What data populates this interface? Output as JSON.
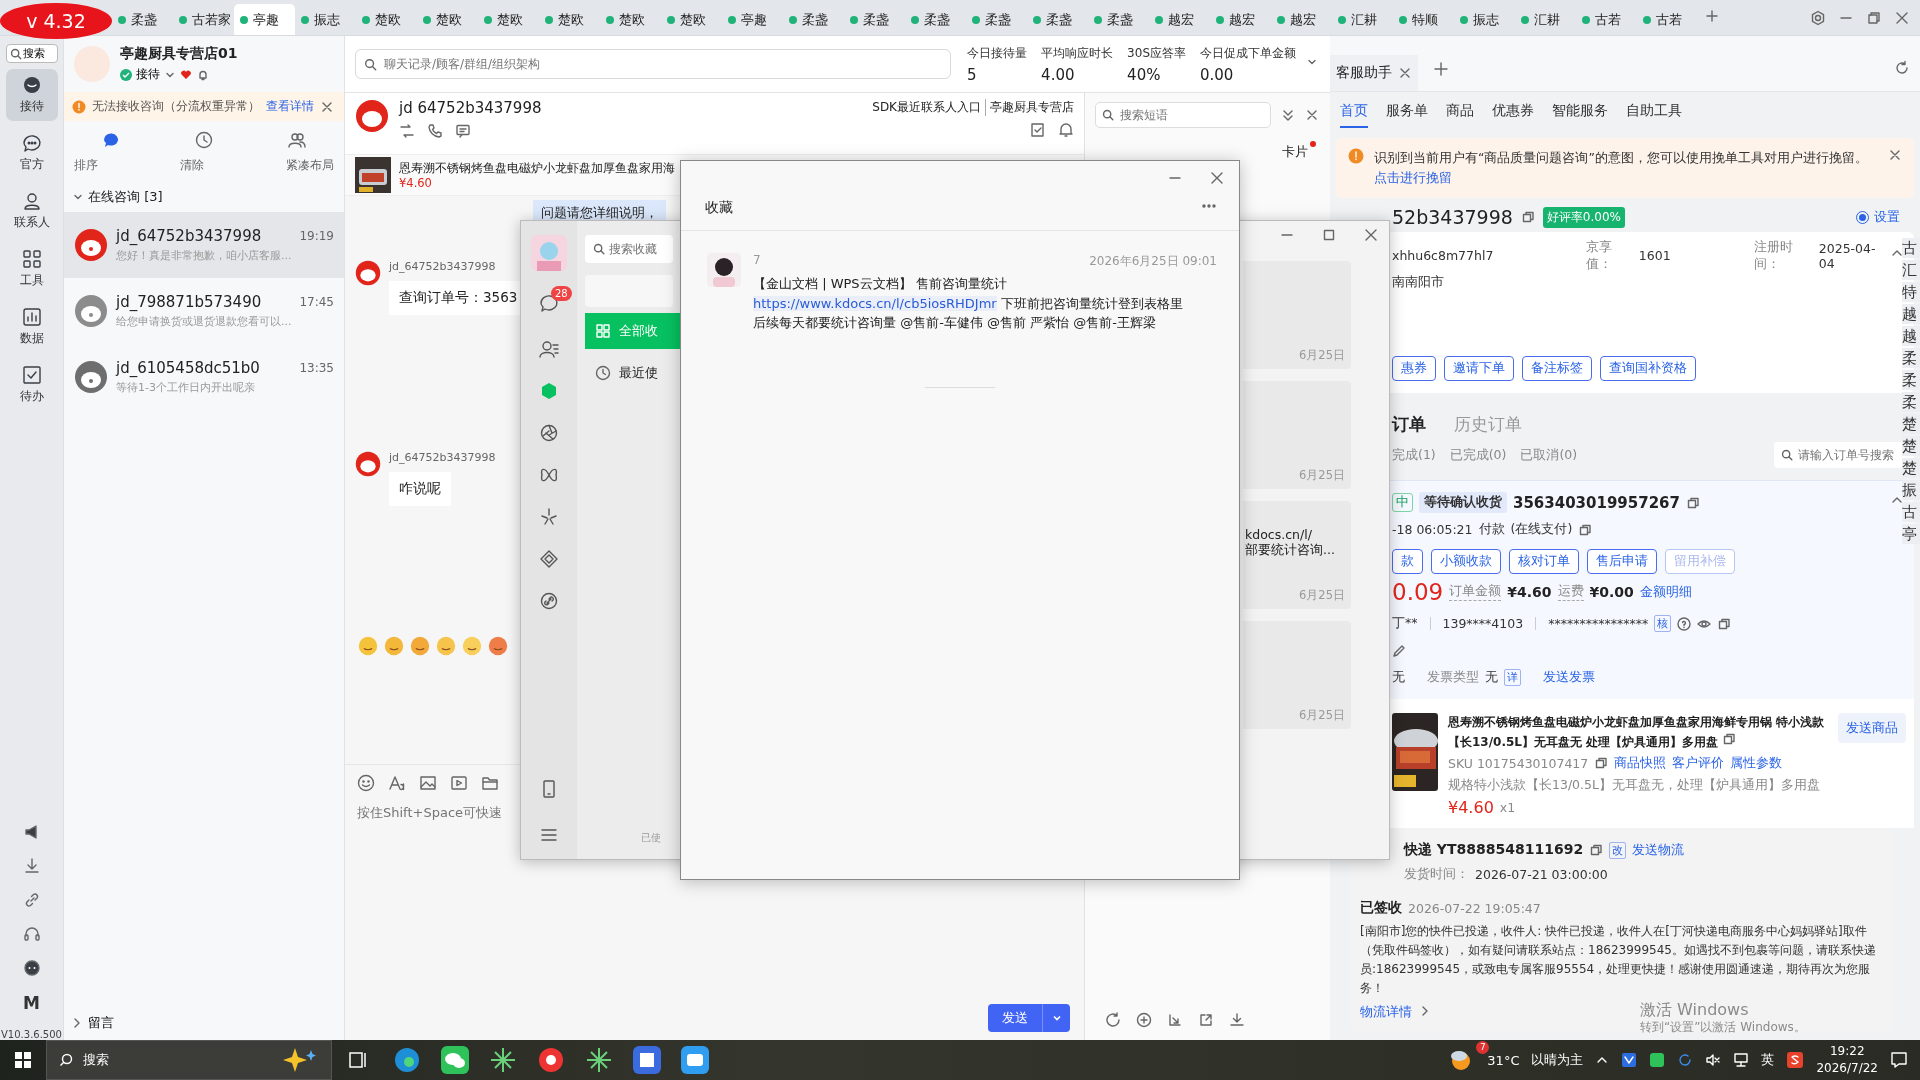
{
  "version_badge": "v 4.32",
  "top_tabs": [
    {
      "label": "柔盏",
      "selected": false
    },
    {
      "label": "古若家",
      "selected": false
    },
    {
      "label": "亭趣",
      "selected": true
    },
    {
      "label": "振志",
      "selected": false
    },
    {
      "label": "楚欧",
      "selected": false
    },
    {
      "label": "楚欧",
      "selected": false
    },
    {
      "label": "楚欧",
      "selected": false
    },
    {
      "label": "楚欧",
      "selected": false
    },
    {
      "label": "楚欧",
      "selected": false
    },
    {
      "label": "楚欧",
      "selected": false
    },
    {
      "label": "亭趣",
      "selected": false
    },
    {
      "label": "柔盏",
      "selected": false
    },
    {
      "label": "柔盏",
      "selected": false
    },
    {
      "label": "柔盏",
      "selected": false
    },
    {
      "label": "柔盏",
      "selected": false
    },
    {
      "label": "柔盏",
      "selected": false
    },
    {
      "label": "柔盏",
      "selected": false
    },
    {
      "label": "越宏",
      "selected": false
    },
    {
      "label": "越宏",
      "selected": false
    },
    {
      "label": "越宏",
      "selected": false
    },
    {
      "label": "汇耕",
      "selected": false
    },
    {
      "label": "特顺",
      "selected": false
    },
    {
      "label": "振志",
      "selected": false
    },
    {
      "label": "汇耕",
      "selected": false
    },
    {
      "label": "古若",
      "selected": false
    },
    {
      "label": "古若",
      "selected": false
    }
  ],
  "nav_rail": {
    "search": "搜索",
    "items": [
      {
        "label": "接待",
        "selected": true
      },
      {
        "label": "官方",
        "selected": false
      },
      {
        "label": "联系人",
        "selected": false
      },
      {
        "label": "工具",
        "selected": false
      },
      {
        "label": "数据",
        "selected": false
      },
      {
        "label": "待办",
        "selected": false
      }
    ],
    "letter": "M",
    "version": "V10.3.6.500"
  },
  "shop": {
    "name": "亭趣厨具专营店01",
    "status": "接待"
  },
  "list_alert": {
    "text": "无法接收咨询（分流权重异常）",
    "link": "查看详情"
  },
  "list_tools": [
    "排序",
    "清除",
    "紧凑布局"
  ],
  "conversations": {
    "group": "在线咨询 [3]",
    "items": [
      {
        "name": "jd_64752b3437998",
        "time": "19:19",
        "preview": "您好！真是非常抱歉，咱小店客服...",
        "selected": true,
        "color": "#e1251b"
      },
      {
        "name": "jd_798871b573490",
        "time": "17:45",
        "preview": "给您申请换货或退货退款您看可以...",
        "selected": false,
        "color": "#8c8c8c"
      },
      {
        "name": "jd_6105458dc51b0",
        "time": "13:35",
        "preview": "等待1-3个工作日内开出呢亲",
        "selected": false,
        "color": "#6e6e6e"
      }
    ]
  },
  "leave_message": "留言",
  "search": {
    "placeholder": "聊天记录/顾客/群组/组织架构"
  },
  "stats": [
    {
      "label": "今日接待量",
      "value": "5"
    },
    {
      "label": "平均响应时长",
      "value": "4.00"
    },
    {
      "label": "30S应答率",
      "value": "40%"
    },
    {
      "label": "今日促成下单金额",
      "value": "0.00"
    }
  ],
  "chat": {
    "customer": "jd 64752b3437998",
    "links": [
      "SDK最近联系人入口",
      "亭趣厨具专营店"
    ],
    "product": {
      "title": "恩寿溯不锈钢烤鱼盘电磁炉小龙虾盘加厚鱼盘家用海",
      "price": "¥4.60"
    },
    "messages": [
      {
        "kind": "agent",
        "text": "问题请您详细说明，"
      },
      {
        "kind": "customer",
        "sender": "jd_64752b3437998",
        "text": "查询订单号：3563"
      },
      {
        "kind": "customer",
        "sender": "jd_64752b3437998",
        "text": "咋说呢"
      }
    ],
    "input_placeholder": "按住Shift+Space可快速",
    "send": "发送"
  },
  "quick_reply": {
    "search_placeholder": "搜索短语",
    "tab": "卡片"
  },
  "assistant": {
    "tab": "客服助手",
    "nav": [
      {
        "label": "首页",
        "selected": true
      },
      {
        "label": "服务单",
        "selected": false
      },
      {
        "label": "商品",
        "selected": false
      },
      {
        "label": "优惠券",
        "selected": false
      },
      {
        "label": "智能服务",
        "selected": false
      },
      {
        "label": "自助工具",
        "selected": false
      }
    ],
    "notice": {
      "text": "识别到当前用户有“商品质量问题咨询”的意图，您可以使用挽单工具对用户进行挽留。",
      "link": "点击进行挽留"
    },
    "user": {
      "id": "52b3437998",
      "rating": "好评率0.00%",
      "settings": {
        "label": "设置",
        "selected": true
      },
      "account": "xhhu6c8m77hl7",
      "jx_label": "京享值：",
      "jx": "1601",
      "reg_label": "注册时间：",
      "reg": "2025-04-04",
      "city": "南南阳市",
      "actions": [
        "惠券",
        "邀请下单",
        "备注标签",
        "查询国补资格"
      ]
    },
    "orders": {
      "tabs": [
        {
          "label": "订单",
          "selected": true
        },
        {
          "label": "历史订单",
          "selected": false
        }
      ],
      "filters": [
        "完成(1)",
        "已完成(0)",
        "已取消(0)"
      ],
      "search_placeholder": "请输入订单号搜索",
      "order": {
        "tag": "中",
        "status": "等待确认收货",
        "number": "3563403019957267",
        "paid_time": "-18 06:05:21",
        "pay_label": "付款",
        "pay_method": "(在线支付)",
        "actions": [
          {
            "label": "款",
            "disabled": false
          },
          {
            "label": "小额收款",
            "disabled": false
          },
          {
            "label": "核对订单",
            "disabled": false
          },
          {
            "label": "售后申请",
            "disabled": false
          },
          {
            "label": "留用补偿",
            "disabled": true
          }
        ],
        "paid_amount": "0.09",
        "amount_label": "订单金额",
        "amount": "¥4.60",
        "freight_label": "运费",
        "freight": "¥0.00",
        "detail_link": "金额明细",
        "receiver": "丁**",
        "phone": "139****4103",
        "address": "****************",
        "verify": "核",
        "invoice_value": "无",
        "invoice_type_label": "发票类型",
        "invoice_type": "无",
        "invoice_detail": "详",
        "send_invoice": "发送发票",
        "product": {
          "title": "恩寿溯不锈钢烤鱼盘电磁炉小龙虾盘加厚鱼盘家用海鲜专用锅 特小浅款【长13/0.5L】无耳盘无 处理【炉具通用】多用盘",
          "send": "发送商品",
          "sku": "SKU 10175430107417",
          "links": [
            "商品快照",
            "客户评价",
            "属性参数"
          ],
          "spec": "规格特小浅款【长13/0.5L】无耳盘无，处理【炉具通用】多用盘",
          "price": "¥4.60",
          "qty": "x1"
        },
        "logistics": {
          "carrier": "快递 YT8888548111692",
          "edit": "改",
          "send": "发送物流",
          "deadline_label": "发货时间：",
          "deadline": "2026-07-21 03:00:00",
          "status": "已签收",
          "time": "2026-07-22 19:05:47",
          "detail": "[南阳市]您的快件已投递，收件人: 快件已投递，收件人在[丁河快递电商服务中心妈妈驿站]取件（凭取件码签收），如有疑问请联系站点：18623999545。如遇找不到包裹等问题，请联系快递员:18623999545，或致电专属客服95554，处理更快捷！感谢使用圆通速递，期待再次为您服务！",
          "more": "物流详情"
        }
      }
    }
  },
  "side_tabs": [
    "古",
    "汇",
    "特",
    "越",
    "越",
    "柔",
    "柔",
    "柔",
    "楚",
    "楚",
    "楚",
    "振",
    "古",
    "亭"
  ],
  "wechat_window": {
    "badge": "28",
    "search_placeholder": "搜索收藏",
    "menu": [
      {
        "label": "全部收",
        "selected": true
      },
      {
        "label": "最近使",
        "selected": false
      }
    ],
    "footer": "已使",
    "cards": [
      {
        "date": "6月25日"
      },
      {
        "date": "6月25日"
      },
      {
        "lines": [
          "kdocs.cn/l/",
          "部要统计咨询..."
        ],
        "date": "6月25日"
      },
      {
        "date": "6月25日"
      }
    ]
  },
  "favorite_dialog": {
    "title": "收藏",
    "item": {
      "sender": "7",
      "time": "2026年6月25日 09:01",
      "heading": "【金山文档 | WPS云文档】 售前咨询量统计",
      "link": "https://www.kdocs.cn/l/cb5iosRHDJmr",
      "link_note": "下班前把咨询量统计登到表格里",
      "body": "后续每天都要统计咨询量 @售前-车健伟  @售前  严紫怡  @售前-王辉梁"
    }
  },
  "os_notice": {
    "title": "激活 Windows",
    "text": "转到“设置”以激活 Windows。"
  },
  "taskbar": {
    "search": "搜索",
    "weather_badge": "7",
    "temperature": "31°C",
    "weather": "以晴为主",
    "ime": "英",
    "time": "19:22",
    "date": "2026/7/22"
  }
}
